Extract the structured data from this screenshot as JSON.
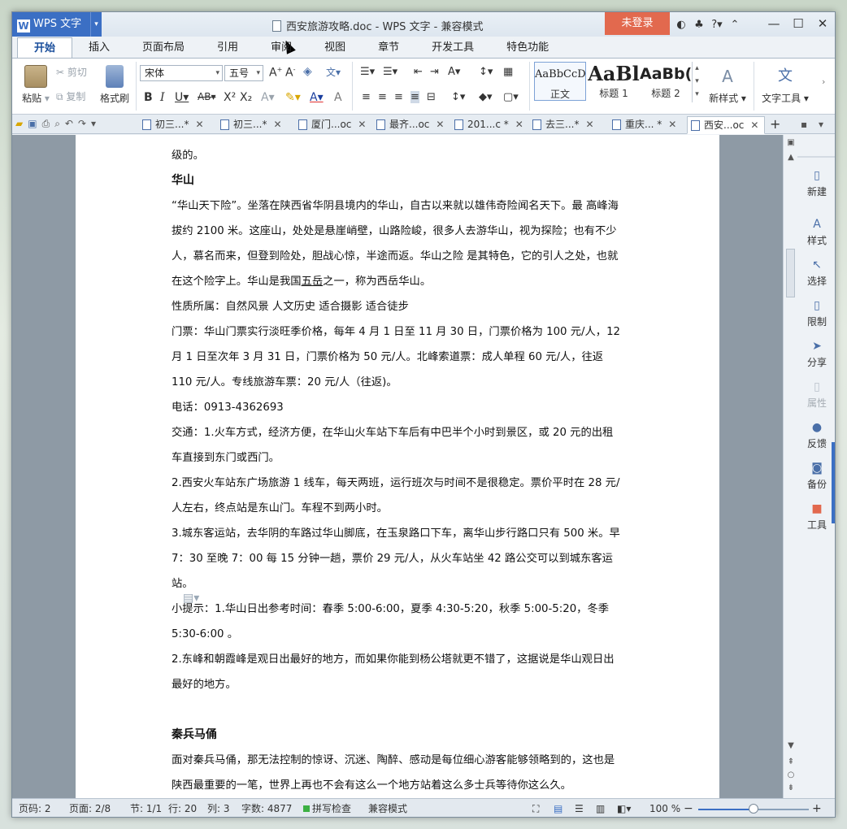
{
  "app": {
    "name": "WPS 文字",
    "document_title": "西安旅游攻略.doc - WPS 文字 - 兼容模式",
    "login_label": "未登录"
  },
  "ribbon_tabs": [
    "开始",
    "插入",
    "页面布局",
    "引用",
    "审阅",
    "视图",
    "章节",
    "开发工具",
    "特色功能"
  ],
  "ribbon": {
    "paste_label": "粘贴",
    "cut_label": "剪切",
    "copy_label": "复制",
    "format_painter_label": "格式刷",
    "font_name": "宋体",
    "font_size": "五号",
    "styles": [
      {
        "sample": "AaBbCcD",
        "name": "正文"
      },
      {
        "sample": "AaBl",
        "name": "标题 1"
      },
      {
        "sample": "AaBb(",
        "name": "标题 2"
      }
    ],
    "new_style_label": "新样式",
    "text_tools_label": "文字工具"
  },
  "doc_tabs": [
    {
      "label": "初三...*",
      "active": false
    },
    {
      "label": "初三...*",
      "active": false
    },
    {
      "label": "厦门...oc",
      "active": false
    },
    {
      "label": "最齐...oc",
      "active": false
    },
    {
      "label": "201...c *",
      "active": false
    },
    {
      "label": "去三...*",
      "active": false
    },
    {
      "label": "重庆... *",
      "active": false
    },
    {
      "label": "西安...oc",
      "active": true
    }
  ],
  "document": {
    "p0": "级的。",
    "heading1": "华山",
    "p1a": "“华山天下险”。坐落在陕西省华阴县境内的华山，自古以来就以雄伟奇险闻名天下。最 高峰海拔约 2100 米。这座山，处处是悬崖峭壁，山路险峻，很多人去游华山，视为探险；也有不少人，慕名而来，但登到险处，胆战心惊，半途而返。华山之险 是其特色，它的引人之处，也就在这个险字上。华山是我国",
    "p1u": "五岳",
    "p1b": "之一，称为西岳华山。",
    "p2": "性质所属：自然风景 人文历史 适合摄影 适合徒步",
    "p3": "门票：华山门票实行淡旺季价格，每年 4 月 1 日至 11 月 30 日，门票价格为 100 元/人，12 月 1 日至次年 3 月 31 日，门票价格为 50 元/人。北峰索道票：成人单程 60 元/人，往返 110 元/人。专线旅游车票：20 元/人（往返)。",
    "p4": "电话：0913-4362693",
    "p5": "交通：1.火车方式，经济方便，在华山火车站下车后有中巴半个小时到景区，或 20 元的出租车直接到东门或西门。",
    "p6": "2.西安火车站东广场旅游 1 线车，每天两班，运行班次与时间不是很稳定。票价平时在 28 元/人左右，终点站是东山门。车程不到两小时。",
    "p7": "3.城东客运站，去华阴的车路过华山脚底，在玉泉路口下车，离华山步行路口只有 500 米。早 7：30 至晚 7：00 每 15 分钟一趟，票价 29 元/人，从火车站坐 42 路公交可以到城东客运站。",
    "p8": "小提示：1.华山日出参考时间：春季 5:00-6:00，夏季 4:30-5:20，秋季 5:00-5:20，冬季 5:30-6:00 。",
    "p9": "2.东峰和朝霞峰是观日出最好的地方，而如果你能到杨公塔就更不错了，这据说是华山观日出最好的地方。",
    "heading2": "秦兵马俑",
    "p10": "面对秦兵马俑，那无法控制的惊讶、沉迷、陶醉、感动是每位细心游客能够领略到的，这也是陕西最重要的一笔，世界上再也不会有这么一个地方站着这么多士兵等待你这么久。"
  },
  "right_panel": [
    {
      "label": "新建",
      "icon": "new-doc-icon",
      "enabled": true
    },
    {
      "label": "样式",
      "icon": "style-icon",
      "enabled": true
    },
    {
      "label": "选择",
      "icon": "select-icon",
      "enabled": true
    },
    {
      "label": "限制",
      "icon": "restrict-icon",
      "enabled": true
    },
    {
      "label": "分享",
      "icon": "share-icon",
      "enabled": true
    },
    {
      "label": "属性",
      "icon": "properties-icon",
      "enabled": false
    },
    {
      "label": "反馈",
      "icon": "feedback-icon",
      "enabled": true
    },
    {
      "label": "备份",
      "icon": "backup-icon",
      "enabled": true
    },
    {
      "label": "工具",
      "icon": "toolbox-icon",
      "enabled": true
    }
  ],
  "status": {
    "page_num": "页码: 2",
    "page_of": "页面: 2/8",
    "section": "节: 1/1",
    "row": "行: 20",
    "col": "列: 3",
    "word_count": "字数: 4877",
    "spell_check": "拼写检查",
    "compat_mode": "兼容模式",
    "zoom": "100 %",
    "zoom_fraction": 0.5
  },
  "colors": {
    "accent": "#3b6fc4",
    "login": "#e2694e"
  }
}
